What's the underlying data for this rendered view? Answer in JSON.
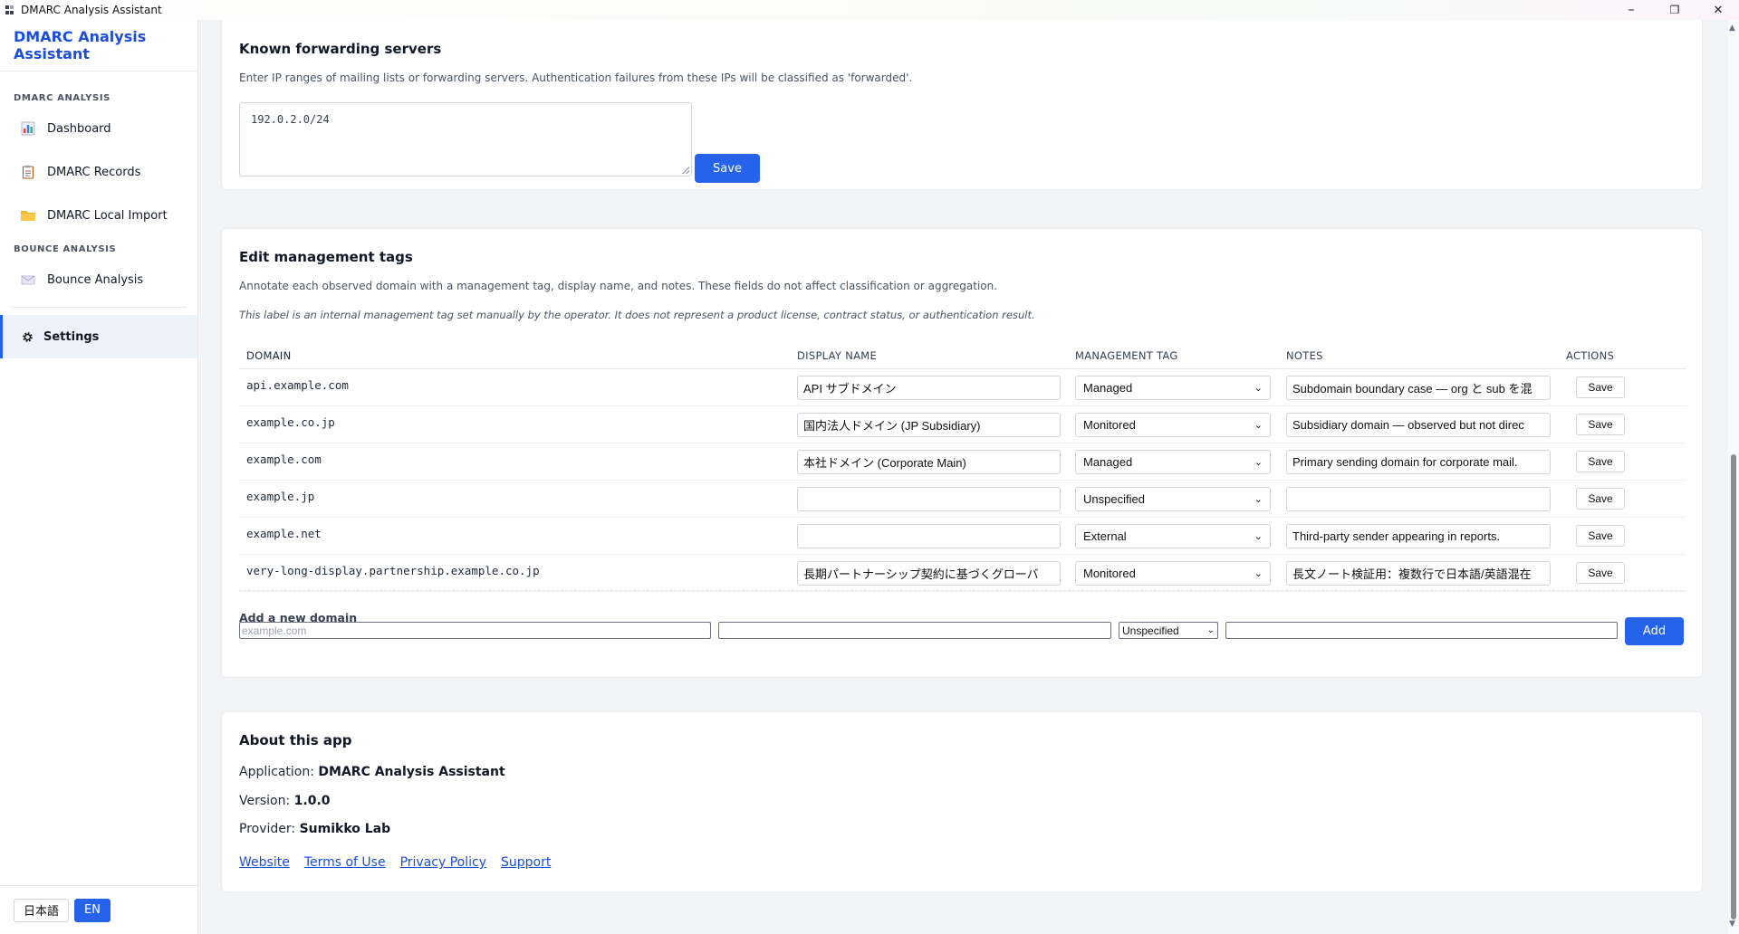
{
  "window": {
    "title": "DMARC Analysis Assistant",
    "minimize": "–",
    "maximize": "❐",
    "close": "✕"
  },
  "sidebar": {
    "brand": "DMARC Analysis Assistant",
    "sections": [
      {
        "title": "DMARC ANALYSIS",
        "items": [
          {
            "label": "Dashboard",
            "icon": "bar-chart-icon"
          },
          {
            "label": "DMARC Records",
            "icon": "clipboard-icon"
          },
          {
            "label": "DMARC Local Import",
            "icon": "folder-icon"
          }
        ]
      },
      {
        "title": "BOUNCE ANALYSIS",
        "items": [
          {
            "label": "Bounce Analysis",
            "icon": "envelope-icon"
          }
        ]
      }
    ],
    "settings": {
      "label": "Settings",
      "icon": "gear-icon"
    },
    "languages": [
      "日本語",
      "EN"
    ],
    "active_language": "EN"
  },
  "forwarding": {
    "title": "Known forwarding servers",
    "description": "Enter IP ranges of mailing lists or forwarding servers. Authentication failures from these IPs will be classified as 'forwarded'.",
    "value": "192.0.2.0/24",
    "save_label": "Save"
  },
  "tags": {
    "title": "Edit management tags",
    "description": "Annotate each observed domain with a management tag, display name, and notes. These fields do not affect classification or aggregation.",
    "note": "This label is an internal management tag set manually by the operator. It does not represent a product license, contract status, or authentication result.",
    "columns": [
      "DOMAIN",
      "DISPLAY NAME",
      "MANAGEMENT TAG",
      "NOTES",
      "ACTIONS"
    ],
    "rows": [
      {
        "domain": "api.example.com",
        "display_name": "API サブドメイン",
        "tag": "Managed",
        "notes": "Subdomain boundary case — org と sub を混",
        "action": "Save"
      },
      {
        "domain": "example.co.jp",
        "display_name": "国内法人ドメイン (JP Subsidiary)",
        "tag": "Monitored",
        "notes": "Subsidiary domain — observed but not direc",
        "action": "Save"
      },
      {
        "domain": "example.com",
        "display_name": "本社ドメイン (Corporate Main)",
        "tag": "Managed",
        "notes": "Primary sending domain for corporate mail.",
        "action": "Save"
      },
      {
        "domain": "example.jp",
        "display_name": "",
        "tag": "Unspecified",
        "notes": "",
        "action": "Save"
      },
      {
        "domain": "example.net",
        "display_name": "",
        "tag": "External",
        "notes": "Third-party sender appearing in reports.",
        "action": "Save"
      },
      {
        "domain": "very-long-display.partnership.example.co.jp",
        "display_name": "長期パートナーシップ契約に基づくグローバ",
        "tag": "Monitored",
        "notes": "長文ノート検証用：複数行で日本語/英語混在",
        "action": "Save"
      }
    ],
    "add": {
      "title": "Add a new domain",
      "domain_placeholder": "example.com",
      "tag_value": "Unspecified",
      "button": "Add"
    }
  },
  "about": {
    "title": "About this app",
    "app_label": "Application:",
    "app_value": "DMARC Analysis Assistant",
    "version_label": "Version:",
    "version_value": "1.0.0",
    "provider_label": "Provider:",
    "provider_value": "Sumikko Lab",
    "links": [
      "Website",
      "Terms of Use",
      "Privacy Policy",
      "Support"
    ]
  },
  "colors": {
    "accent": "#2563eb",
    "brand": "#1d4ed8",
    "active_nav_bg": "#eef2fb"
  }
}
